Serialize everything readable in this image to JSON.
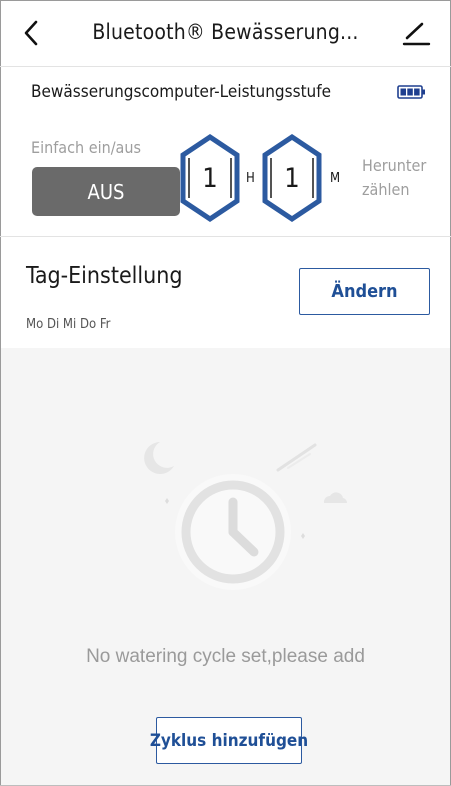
{
  "header": {
    "title": "Bluetooth® Bewässerung...",
    "back_icon": "chevron-left-icon",
    "edit_icon": "pencil-icon"
  },
  "power": {
    "label": "Bewässerungscomputer-Leistungsstufe",
    "battery_icon": "battery-full-icon",
    "battery_level": 1.0
  },
  "switch": {
    "label": "Einfach ein/aus",
    "state_label": "AUS"
  },
  "timer": {
    "hours": "1",
    "hours_unit": "H",
    "minutes": "1",
    "minutes_unit": "M",
    "countdown_line1": "Herunter",
    "countdown_line2": "zählen"
  },
  "day_setting": {
    "title": "Tag-Einstellung",
    "days": "Mo Di Mi Do Fr",
    "change_label": "Ändern"
  },
  "empty_state": {
    "illustration_icon": "clock-icon",
    "message": "No watering cycle set,please add",
    "add_label": "Zyklus hinzufügen"
  },
  "colors": {
    "accent": "#1f4f96",
    "hex_blue": "#2c5aa0",
    "switch_bg": "#6a6a6a",
    "empty_bg": "#f5f5f5"
  }
}
